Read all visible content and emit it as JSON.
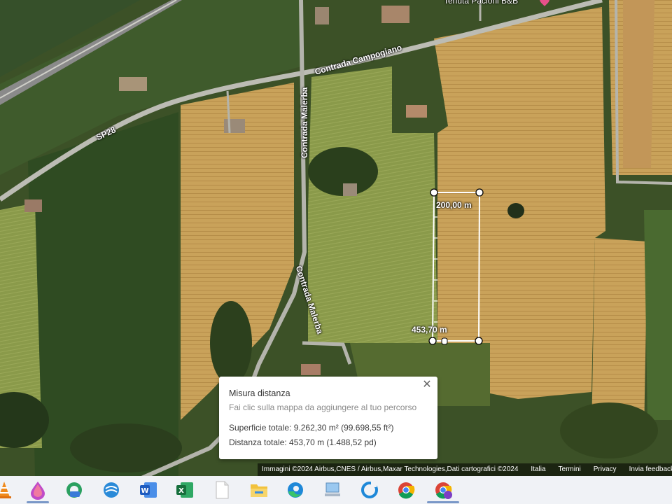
{
  "map": {
    "roads": {
      "campogiano": "Contrada Campogiano",
      "sp28": "SP28",
      "malerba_north": "Contrada Malerba",
      "malerba_south": "Contrada Malerba"
    },
    "poi": {
      "name": "Tenuta Pacioni B&B"
    },
    "measure": {
      "segment_label": "200,00 m",
      "total_label": "453,70 m"
    }
  },
  "panel": {
    "title": "Misura distanza",
    "hint": "Fai clic sulla mappa da aggiungere al tuo percorso",
    "area": "Superficie totale: 9.262,30 m² (99.698,55 ft²)",
    "distance": "Distanza totale: 453,70 m (1.488,52 pd)",
    "close_icon": "close-icon"
  },
  "attribution": {
    "imagery": "Immagini ©2024 Airbus,CNES / Airbus,Maxar Technologies,Dati cartografici ©2024",
    "country": "Italia",
    "terms": "Termini",
    "privacy": "Privacy",
    "feedback": "Invia feedback"
  },
  "taskbar": {
    "icons": [
      "vlc-icon",
      "paint-icon",
      "edge-dev-icon",
      "app-icon",
      "word-icon",
      "excel-icon",
      "file-icon",
      "file-explorer-icon",
      "edge-icon",
      "network-icon",
      "sync-icon",
      "chrome-icon",
      "chrome-profile-icon"
    ]
  },
  "colors": {
    "field_yellow": "#c9a25a",
    "field_green": "#3f5a26",
    "road": "#b8b8b0",
    "measure_line": "#ffffff",
    "pin": "#e8508a"
  }
}
